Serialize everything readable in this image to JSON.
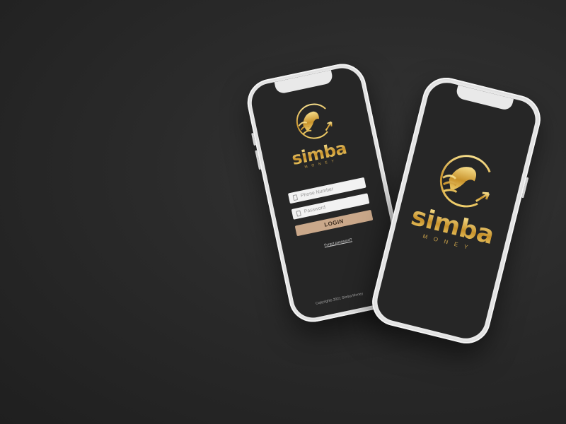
{
  "brand": {
    "name": "simba",
    "subtitle": "MONEY"
  },
  "login": {
    "phone_placeholder": "Phone Number",
    "password_placeholder": "Password",
    "login_label": "LOGIN",
    "forgot_label": "Forgot password?",
    "copyright": "Copyrights 2021 Simba Money"
  },
  "colors": {
    "gold": "#d4a53a",
    "button": "#caa88a",
    "background": "#2a2a2a"
  },
  "icons": [
    "lion-logo-icon",
    "phone-field-icon",
    "lock-field-icon"
  ]
}
